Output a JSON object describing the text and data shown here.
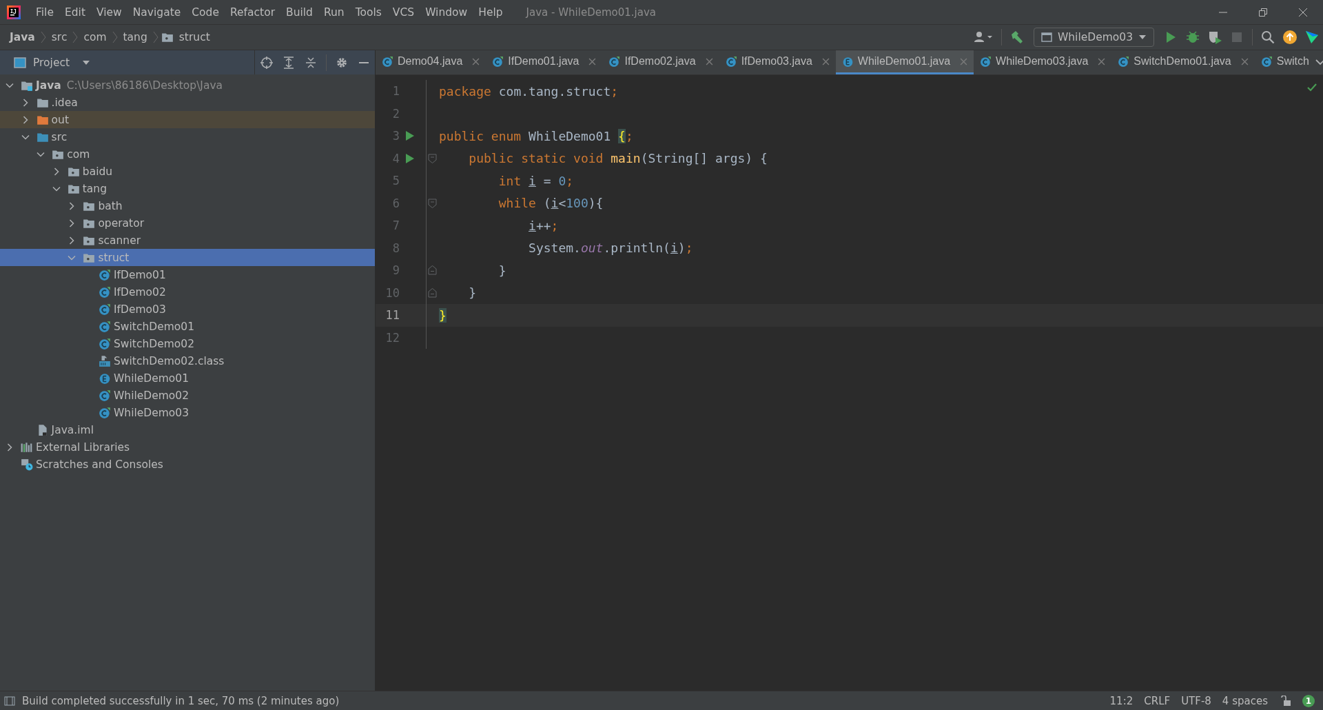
{
  "menu_bar": {
    "items": [
      "File",
      "Edit",
      "View",
      "Navigate",
      "Code",
      "Refactor",
      "Build",
      "Run",
      "Tools",
      "VCS",
      "Window",
      "Help"
    ],
    "title": "Java - WhileDemo01.java"
  },
  "breadcrumbs": [
    {
      "label": "Java",
      "bold": true
    },
    {
      "label": "src",
      "bold": false
    },
    {
      "label": "com",
      "bold": false
    },
    {
      "label": "tang",
      "bold": false
    },
    {
      "label": "struct",
      "bold": false
    }
  ],
  "toolbar": {
    "run_configuration": "WhileDemo03",
    "stop_disabled": true
  },
  "project_panel": {
    "title": "Project",
    "tree": [
      {
        "label": "Java",
        "kind": "project",
        "path": "C:\\Users\\86186\\Desktop\\Java",
        "expanded": true,
        "selected": false,
        "children": [
          {
            "label": ".idea",
            "kind": "folder",
            "expanded": false,
            "selected": false
          },
          {
            "label": "out",
            "kind": "excluded",
            "expanded": false,
            "selected": false
          },
          {
            "label": "src",
            "kind": "source",
            "expanded": true,
            "selected": false,
            "children": [
              {
                "label": "com",
                "kind": "package",
                "expanded": true,
                "selected": false,
                "children": [
                  {
                    "label": "baidu",
                    "kind": "package",
                    "expanded": false,
                    "selected": false
                  },
                  {
                    "label": "tang",
                    "kind": "package",
                    "expanded": true,
                    "selected": false,
                    "children": [
                      {
                        "label": "bath",
                        "kind": "package",
                        "expanded": false,
                        "selected": false
                      },
                      {
                        "label": "operator",
                        "kind": "package",
                        "expanded": false,
                        "selected": false
                      },
                      {
                        "label": "scanner",
                        "kind": "package",
                        "expanded": false,
                        "selected": false
                      },
                      {
                        "label": "struct",
                        "kind": "package",
                        "expanded": true,
                        "selected": true,
                        "children": [
                          {
                            "label": "IfDemo01",
                            "kind": "class",
                            "selected": false
                          },
                          {
                            "label": "IfDemo02",
                            "kind": "class",
                            "selected": false
                          },
                          {
                            "label": "IfDemo03",
                            "kind": "class",
                            "selected": false
                          },
                          {
                            "label": "SwitchDemo01",
                            "kind": "class",
                            "selected": false
                          },
                          {
                            "label": "SwitchDemo02",
                            "kind": "class",
                            "selected": false
                          },
                          {
                            "label": "SwitchDemo02.class",
                            "kind": "classfile",
                            "selected": false
                          },
                          {
                            "label": "WhileDemo01",
                            "kind": "enum",
                            "selected": false
                          },
                          {
                            "label": "WhileDemo02",
                            "kind": "class",
                            "selected": false
                          },
                          {
                            "label": "WhileDemo03",
                            "kind": "class",
                            "selected": false
                          }
                        ]
                      }
                    ]
                  }
                ]
              }
            ]
          },
          {
            "label": "Java.iml",
            "kind": "module",
            "selected": false
          }
        ]
      },
      {
        "label": "External Libraries",
        "kind": "libraries",
        "expanded": false,
        "selected": false
      },
      {
        "label": "Scratches and Consoles",
        "kind": "scratches",
        "selected": false
      }
    ]
  },
  "tabs": [
    {
      "label": "Demo04.java",
      "kind": "class",
      "selected": false,
      "closable": true
    },
    {
      "label": "IfDemo01.java",
      "kind": "class",
      "selected": false,
      "closable": true
    },
    {
      "label": "IfDemo02.java",
      "kind": "class",
      "selected": false,
      "closable": true
    },
    {
      "label": "IfDemo03.java",
      "kind": "class",
      "selected": false,
      "closable": true
    },
    {
      "label": "WhileDemo01.java",
      "kind": "enum",
      "selected": true,
      "closable": true
    },
    {
      "label": "WhileDemo03.java",
      "kind": "class",
      "selected": false,
      "closable": true
    },
    {
      "label": "SwitchDemo01.java",
      "kind": "class",
      "selected": false,
      "closable": true
    },
    {
      "label": "Switch",
      "kind": "class",
      "selected": false,
      "closable": false
    }
  ],
  "editor": {
    "lines": [
      {
        "number": "1",
        "current": false,
        "run_marker": false,
        "fold_start": false,
        "fold_end": false,
        "tokens": [
          {
            "text": "package",
            "kind": "keyword"
          },
          {
            "text": " com.tang.struct",
            "kind": "plain"
          },
          {
            "text": ";",
            "kind": "keyword"
          }
        ]
      },
      {
        "number": "2",
        "current": false,
        "run_marker": false,
        "fold_start": false,
        "fold_end": false
      },
      {
        "number": "3",
        "current": false,
        "run_marker": true,
        "fold_start": false,
        "fold_end": false,
        "tokens": [
          {
            "text": "public enum",
            "kind": "keyword"
          },
          {
            "text": " WhileDemo01 ",
            "kind": "plain"
          },
          {
            "text": "{",
            "kind": "brace-match"
          },
          {
            "text": ";",
            "kind": "keyword"
          }
        ]
      },
      {
        "number": "4",
        "current": false,
        "run_marker": true,
        "fold_start": true,
        "fold_end": false,
        "tokens": [
          {
            "text": "    public static void",
            "kind": "keyword"
          },
          {
            "text": " main",
            "kind": "method"
          },
          {
            "text": "(String[] args) {",
            "kind": "plain"
          }
        ]
      },
      {
        "number": "5",
        "current": false,
        "run_marker": false,
        "fold_start": false,
        "fold_end": false,
        "tokens": [
          {
            "text": "        int",
            "kind": "keyword"
          },
          {
            "text": " i",
            "kind": "var"
          },
          {
            "text": " = ",
            "kind": "plain"
          },
          {
            "text": "0",
            "kind": "number"
          },
          {
            "text": ";",
            "kind": "keyword"
          }
        ]
      },
      {
        "number": "6",
        "current": false,
        "run_marker": false,
        "fold_start": true,
        "fold_end": false,
        "tokens": [
          {
            "text": "        while",
            "kind": "keyword"
          },
          {
            "text": " (",
            "kind": "plain"
          },
          {
            "text": "i",
            "kind": "var"
          },
          {
            "text": "<",
            "kind": "plain"
          },
          {
            "text": "100",
            "kind": "number"
          },
          {
            "text": "){",
            "kind": "plain"
          }
        ]
      },
      {
        "number": "7",
        "current": false,
        "run_marker": false,
        "fold_start": false,
        "fold_end": false,
        "tokens": [
          {
            "text": "            i",
            "kind": "var"
          },
          {
            "text": "++",
            "kind": "plain"
          },
          {
            "text": ";",
            "kind": "keyword"
          }
        ]
      },
      {
        "number": "8",
        "current": false,
        "run_marker": false,
        "fold_start": false,
        "fold_end": false,
        "tokens": [
          {
            "text": "            System.",
            "kind": "plain"
          },
          {
            "text": "out",
            "kind": "field"
          },
          {
            "text": ".println(",
            "kind": "plain"
          },
          {
            "text": "i",
            "kind": "var"
          },
          {
            "text": ")",
            "kind": "plain"
          },
          {
            "text": ";",
            "kind": "keyword"
          }
        ]
      },
      {
        "number": "9",
        "current": false,
        "run_marker": false,
        "fold_start": false,
        "fold_end": true,
        "tokens": [
          {
            "text": "        }",
            "kind": "plain"
          }
        ]
      },
      {
        "number": "10",
        "current": false,
        "run_marker": false,
        "fold_start": false,
        "fold_end": true,
        "tokens": [
          {
            "text": "    }",
            "kind": "plain"
          }
        ]
      },
      {
        "number": "11",
        "current": true,
        "run_marker": false,
        "fold_start": false,
        "fold_end": false,
        "tokens": [
          {
            "text": "}",
            "kind": "brace-match"
          }
        ]
      },
      {
        "number": "12",
        "current": false,
        "run_marker": false,
        "fold_start": false,
        "fold_end": false
      }
    ]
  },
  "status_bar": {
    "message": "Build completed successfully in 1 sec, 70 ms (2 minutes ago)",
    "items": [
      "11:2",
      "CRLF",
      "UTF-8",
      "4 spaces"
    ],
    "notifications": "1"
  }
}
